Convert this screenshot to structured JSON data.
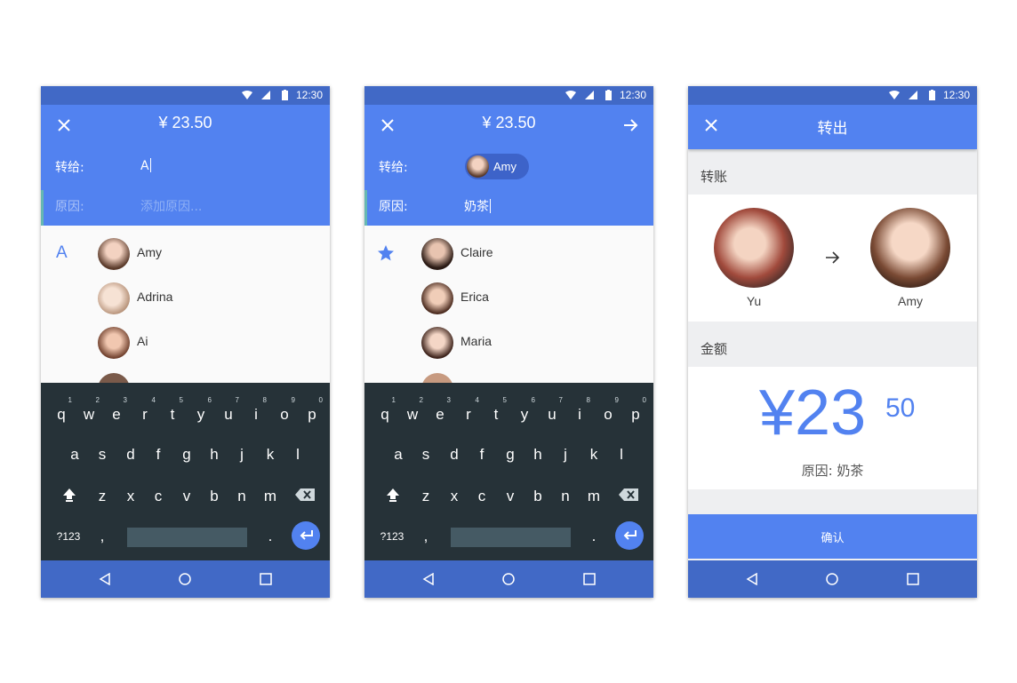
{
  "status": {
    "time": "12:30"
  },
  "screen1": {
    "amount": "¥ 23.50",
    "to_label": "转给:",
    "to_value": "A",
    "reason_label": "原因:",
    "reason_placeholder": "添加原因...",
    "index_letter": "A",
    "contacts": [
      "Amy",
      "Adrina",
      "Ai"
    ]
  },
  "screen2": {
    "amount": "¥ 23.50",
    "to_label": "转给:",
    "chip_name": "Amy",
    "reason_label": "原因:",
    "reason_value": "奶茶",
    "contacts": [
      "Claire",
      "Erica",
      "Maria"
    ]
  },
  "screen3": {
    "title": "转出",
    "transfer_section": "转账",
    "from_name": "Yu",
    "to_name": "Amy",
    "amount_section": "金额",
    "amount_main": "¥23",
    "amount_cents": "50",
    "reason_line": "原因: 奶茶",
    "confirm": "确认"
  },
  "keyboard": {
    "row1": [
      "q",
      "w",
      "e",
      "r",
      "t",
      "y",
      "u",
      "i",
      "o",
      "p"
    ],
    "row1_nums": [
      "1",
      "2",
      "3",
      "4",
      "5",
      "6",
      "7",
      "8",
      "9",
      "0"
    ],
    "row2": [
      "a",
      "s",
      "d",
      "f",
      "g",
      "h",
      "j",
      "k",
      "l"
    ],
    "row3": [
      "z",
      "x",
      "c",
      "v",
      "b",
      "n",
      "m"
    ],
    "symbols": "?123",
    "comma": ",",
    "period": "."
  },
  "colors": {
    "primary": "#5282f0",
    "status": "#4169c6",
    "keyboard": "#263238",
    "accent_text": "#5282f0"
  },
  "icons": [
    "wifi-icon",
    "signal-icon",
    "battery-icon",
    "close-icon",
    "arrow-right-icon",
    "star-icon",
    "shift-icon",
    "backspace-icon",
    "enter-icon",
    "back-icon",
    "home-icon",
    "recents-icon"
  ]
}
